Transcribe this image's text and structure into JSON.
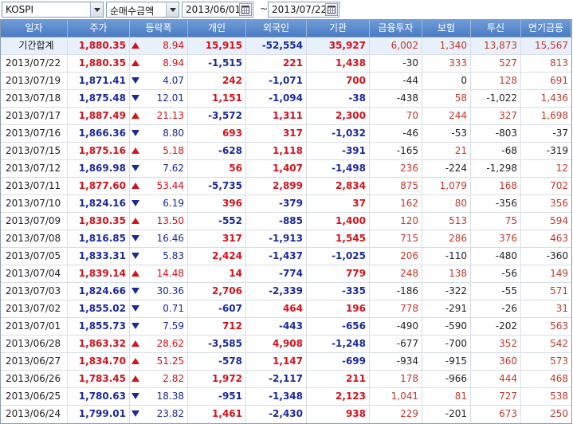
{
  "toolbar": {
    "market": "KOSPI",
    "metric": "순매수금액",
    "date_from": "2013/06/01",
    "date_sep": "~",
    "date_to": "2013/07/22"
  },
  "colors": {
    "header_bg": "#5a89cc",
    "up": "#d5121b",
    "down": "#1a2a9a",
    "total_row_bg": "#e8f0fb"
  },
  "columns": [
    "일자",
    "주가",
    "등락폭",
    "개인",
    "외국인",
    "기관",
    "금융투자",
    "보험",
    "투신",
    "연기금등"
  ],
  "total": {
    "label": "기간합계",
    "price": "1,880.35",
    "dir": "up",
    "change": "8.94",
    "individual": "15,915",
    "foreign": "-52,554",
    "institution": "35,927",
    "fin_invest": "6,002",
    "insurance": "1,340",
    "trust": "13,873",
    "pension": "15,567"
  },
  "rows": [
    {
      "date": "2013/07/22",
      "price": "1,880.35",
      "dir": "up",
      "change": "8.94",
      "individual": "-1,515",
      "foreign": "221",
      "institution": "1,438",
      "fin_invest": "-30",
      "insurance": "333",
      "trust": "527",
      "pension": "813"
    },
    {
      "date": "2013/07/19",
      "price": "1,871.41",
      "dir": "down",
      "change": "4.07",
      "individual": "242",
      "foreign": "-1,071",
      "institution": "700",
      "fin_invest": "-44",
      "insurance": "0",
      "trust": "128",
      "pension": "691"
    },
    {
      "date": "2013/07/18",
      "price": "1,875.48",
      "dir": "down",
      "change": "12.01",
      "individual": "1,151",
      "foreign": "-1,094",
      "institution": "-38",
      "fin_invest": "-438",
      "insurance": "58",
      "trust": "-1,022",
      "pension": "1,436"
    },
    {
      "date": "2013/07/17",
      "price": "1,887.49",
      "dir": "up",
      "change": "21.13",
      "individual": "-3,572",
      "foreign": "1,311",
      "institution": "2,300",
      "fin_invest": "70",
      "insurance": "244",
      "trust": "327",
      "pension": "1,698"
    },
    {
      "date": "2013/07/16",
      "price": "1,866.36",
      "dir": "down",
      "change": "8.80",
      "individual": "693",
      "foreign": "317",
      "institution": "-1,032",
      "fin_invest": "-46",
      "insurance": "-53",
      "trust": "-803",
      "pension": "-37"
    },
    {
      "date": "2013/07/15",
      "price": "1,875.16",
      "dir": "up",
      "change": "5.18",
      "individual": "-628",
      "foreign": "1,118",
      "institution": "-391",
      "fin_invest": "-165",
      "insurance": "21",
      "trust": "-68",
      "pension": "-319"
    },
    {
      "date": "2013/07/12",
      "price": "1,869.98",
      "dir": "down",
      "change": "7.62",
      "individual": "56",
      "foreign": "1,407",
      "institution": "-1,498",
      "fin_invest": "236",
      "insurance": "-224",
      "trust": "-1,298",
      "pension": "12"
    },
    {
      "date": "2013/07/11",
      "price": "1,877.60",
      "dir": "up",
      "change": "53.44",
      "individual": "-5,735",
      "foreign": "2,899",
      "institution": "2,834",
      "fin_invest": "875",
      "insurance": "1,079",
      "trust": "168",
      "pension": "702"
    },
    {
      "date": "2013/07/10",
      "price": "1,824.16",
      "dir": "down",
      "change": "6.19",
      "individual": "396",
      "foreign": "-379",
      "institution": "37",
      "fin_invest": "162",
      "insurance": "80",
      "trust": "-356",
      "pension": "356"
    },
    {
      "date": "2013/07/09",
      "price": "1,830.35",
      "dir": "up",
      "change": "13.50",
      "individual": "-552",
      "foreign": "-885",
      "institution": "1,400",
      "fin_invest": "120",
      "insurance": "513",
      "trust": "75",
      "pension": "594"
    },
    {
      "date": "2013/07/08",
      "price": "1,816.85",
      "dir": "down",
      "change": "16.46",
      "individual": "317",
      "foreign": "-1,913",
      "institution": "1,545",
      "fin_invest": "715",
      "insurance": "286",
      "trust": "376",
      "pension": "463"
    },
    {
      "date": "2013/07/05",
      "price": "1,833.31",
      "dir": "down",
      "change": "5.83",
      "individual": "2,424",
      "foreign": "-1,437",
      "institution": "-1,025",
      "fin_invest": "206",
      "insurance": "-110",
      "trust": "-480",
      "pension": "-360"
    },
    {
      "date": "2013/07/04",
      "price": "1,839.14",
      "dir": "up",
      "change": "14.48",
      "individual": "14",
      "foreign": "-774",
      "institution": "779",
      "fin_invest": "248",
      "insurance": "138",
      "trust": "-56",
      "pension": "149"
    },
    {
      "date": "2013/07/03",
      "price": "1,824.66",
      "dir": "down",
      "change": "30.36",
      "individual": "2,706",
      "foreign": "-2,339",
      "institution": "-335",
      "fin_invest": "-186",
      "insurance": "-322",
      "trust": "-55",
      "pension": "571"
    },
    {
      "date": "2013/07/02",
      "price": "1,855.02",
      "dir": "down",
      "change": "0.71",
      "individual": "-607",
      "foreign": "464",
      "institution": "196",
      "fin_invest": "778",
      "insurance": "-291",
      "trust": "-26",
      "pension": "31"
    },
    {
      "date": "2013/07/01",
      "price": "1,855.73",
      "dir": "down",
      "change": "7.59",
      "individual": "712",
      "foreign": "-443",
      "institution": "-656",
      "fin_invest": "-490",
      "insurance": "-590",
      "trust": "-202",
      "pension": "563"
    },
    {
      "date": "2013/06/28",
      "price": "1,863.32",
      "dir": "up",
      "change": "28.62",
      "individual": "-3,585",
      "foreign": "4,908",
      "institution": "-1,248",
      "fin_invest": "-677",
      "insurance": "-700",
      "trust": "352",
      "pension": "542"
    },
    {
      "date": "2013/06/27",
      "price": "1,834.70",
      "dir": "up",
      "change": "51.25",
      "individual": "-578",
      "foreign": "1,147",
      "institution": "-699",
      "fin_invest": "-934",
      "insurance": "-915",
      "trust": "360",
      "pension": "573"
    },
    {
      "date": "2013/06/26",
      "price": "1,783.45",
      "dir": "up",
      "change": "2.82",
      "individual": "1,972",
      "foreign": "-2,117",
      "institution": "211",
      "fin_invest": "178",
      "insurance": "-966",
      "trust": "444",
      "pension": "468"
    },
    {
      "date": "2013/06/25",
      "price": "1,780.63",
      "dir": "down",
      "change": "18.38",
      "individual": "-951",
      "foreign": "-1,348",
      "institution": "2,123",
      "fin_invest": "1,041",
      "insurance": "81",
      "trust": "727",
      "pension": "538"
    },
    {
      "date": "2013/06/24",
      "price": "1,799.01",
      "dir": "down",
      "change": "23.82",
      "individual": "1,461",
      "foreign": "-2,430",
      "institution": "938",
      "fin_invest": "229",
      "insurance": "-201",
      "trust": "673",
      "pension": "250"
    }
  ]
}
